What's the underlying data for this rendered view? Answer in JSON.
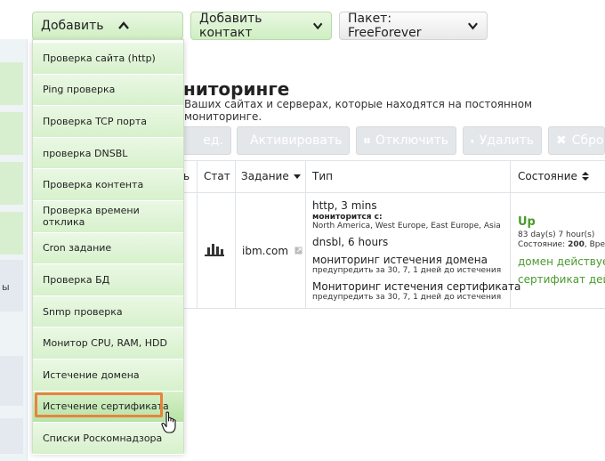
{
  "toolbar": {
    "add_label": "Добавить",
    "add_contact_label": "Добавить контакт",
    "package_label": "Пакет: FreeForever"
  },
  "page": {
    "title_partial": "ниторинге",
    "subtitle": "Ваших сайтах и серверах, которые находятся на постоянном мониторинге."
  },
  "actions": {
    "edit_partial": "ед.",
    "activate": "Активировать",
    "disable": "Отключить",
    "delete": "Удалить",
    "reset_partial": "Сбро"
  },
  "table": {
    "headers": {
      "col0_partial": "ь",
      "stat": "Стат",
      "task": "Задание",
      "type": "Тип",
      "state": "Состояние"
    },
    "row": {
      "task": "ibm.com",
      "type": {
        "http": "http, 3 mins",
        "monitored_from_label": "мониторится с:",
        "locations": "North America, West Europe, East Europe, Asia",
        "dnsbl": "dnsbl, 6 hours",
        "domain_monitor": "мониторинг истечения домена",
        "domain_warn": "предупредить за 30, 7, 1 дней до истечения",
        "cert_monitor": "Мониторинг истечения сертификата",
        "cert_warn": "предупредить за 30, 7, 1 дней до истечения"
      },
      "state": {
        "status": "Up",
        "uptime": "83 day(s) 7 hour(s)",
        "state_prefix": "Состояние:",
        "state_code": "200",
        "state_suffix": ", Вре",
        "domain_status": "домен действует",
        "cert_status": "сертификат дейс"
      }
    }
  },
  "left_strip": {
    "note": "ы"
  },
  "menu": {
    "items": [
      "Проверка сайта (http)",
      "Ping проверка",
      "Проверка TCP порта",
      "проверка DNSBL",
      "Проверка контента",
      "Проверка времени отклика",
      "Cron задание",
      "Проверка БД",
      "Snmp проверка",
      "Монитор CPU, RAM, HDD",
      "Истечение домена",
      "Истечение сертификата",
      "Списки Роскомнадзора"
    ],
    "highlighted_index": 11
  },
  "colors": {
    "menu_green": "#d7f1cc",
    "highlight_border": "#e8833f",
    "status_green": "#4a9a2e"
  }
}
